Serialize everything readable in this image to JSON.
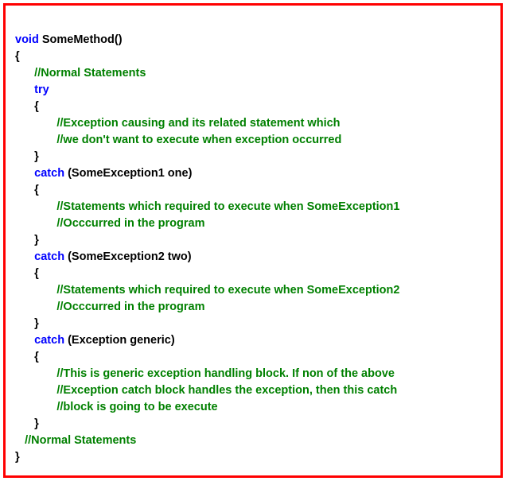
{
  "code": {
    "kw_void": "void",
    "method_sig": " SomeMethod()",
    "brace_open": "{",
    "brace_close": "}",
    "indent_comment_normal1": "      //Normal Statements",
    "kw_try": "      try",
    "try_brace_open": "      {",
    "try_comment1": "             //Exception causing and its related statement which",
    "try_comment2": "             //we don't want to execute when exception occurred",
    "try_brace_close": "      }",
    "kw_catch1_pre": "      ",
    "kw_catch1": "catch",
    "catch1_params": " (SomeException1 one)",
    "catch1_brace_open": "      {",
    "catch1_comment1": "             //Statements which required to execute when SomeException1",
    "catch1_comment2": "             //Occcurred in the program",
    "catch1_brace_close": "      }",
    "kw_catch2_pre": "      ",
    "kw_catch2": "catch",
    "catch2_params": " (SomeException2 two)",
    "catch2_brace_open": "      {",
    "catch2_comment1": "             //Statements which required to execute when SomeException2",
    "catch2_comment2": "             //Occcurred in the program",
    "catch2_brace_close": "      }",
    "kw_catch3_pre": "      ",
    "kw_catch3": "catch",
    "catch3_params": " (Exception generic)",
    "catch3_brace_open": "      {",
    "catch3_comment1": "             //This is generic exception handling block. If non of the above",
    "catch3_comment2": "             //Exception catch block handles the exception, then this catch",
    "catch3_comment3": "             //block is going to be execute",
    "catch3_brace_close": "      }",
    "indent_comment_normal2": "   //Normal Statements"
  }
}
